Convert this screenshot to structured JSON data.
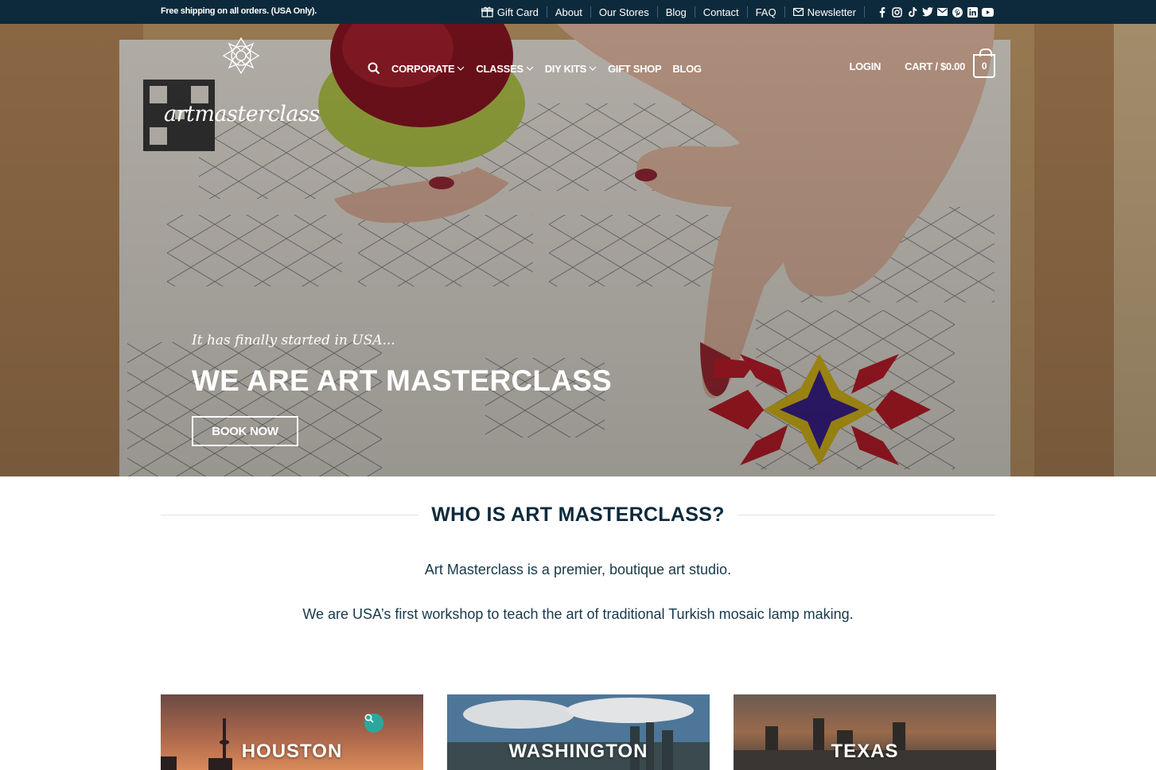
{
  "topbar": {
    "shipping": "Free shipping on all orders. (USA Only).",
    "links": [
      "Gift Card",
      "About",
      "Our Stores",
      "Blog",
      "Contact",
      "FAQ",
      "Newsletter"
    ],
    "socials": [
      "facebook-icon",
      "instagram-icon",
      "tiktok-icon",
      "twitter-icon",
      "envelope-icon",
      "pinterest-icon",
      "linkedin-icon",
      "youtube-icon"
    ]
  },
  "logo": {
    "text": "artmasterclass"
  },
  "nav": {
    "items": [
      "CORPORATE",
      "CLASSES",
      "DIY KITS",
      "GIFT SHOP",
      "BLOG"
    ],
    "login": "LOGIN",
    "cart": "CART / $0.00",
    "cart_count": "0"
  },
  "hero": {
    "tagline": "It has finally started in USA...",
    "headline": "WE ARE ART MASTERCLASS",
    "button": "BOOK NOW"
  },
  "about": {
    "title": "WHO IS ART MASTERCLASS?",
    "p1": "Art Masterclass is a premier, boutique art studio.",
    "p2": "We are USA’s first workshop to teach the art of traditional Turkish mosaic lamp making."
  },
  "cities": [
    "HOUSTON",
    "WASHINGTON",
    "TEXAS"
  ],
  "colors": {
    "navy": "#0d2a3c",
    "teal": "#2aa89f",
    "text": "#18384a"
  }
}
